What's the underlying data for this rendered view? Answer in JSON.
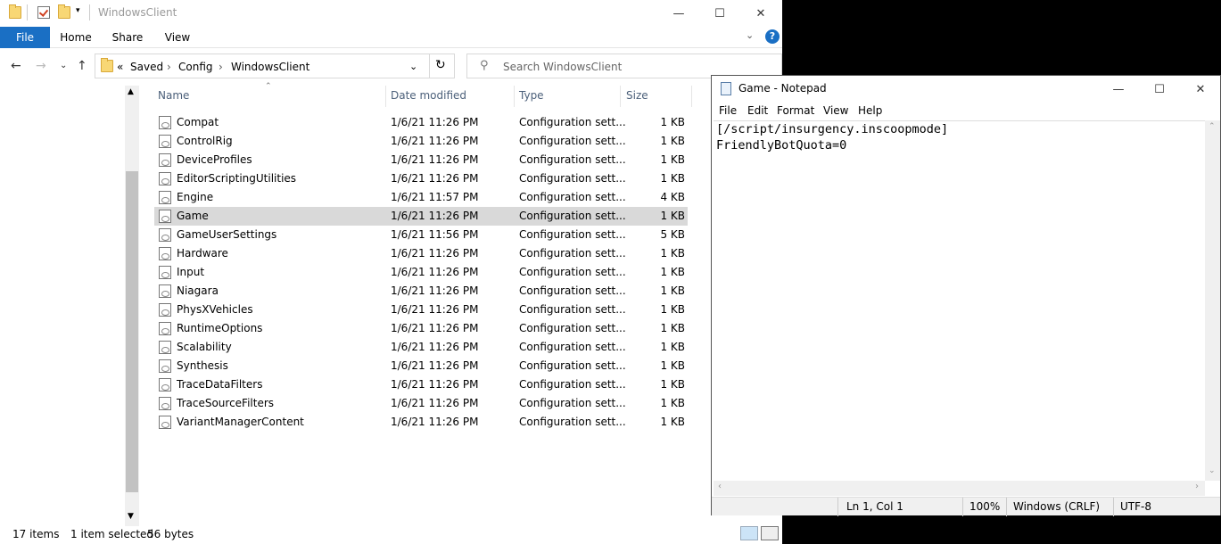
{
  "explorer": {
    "title": "WindowsClient",
    "tabs": {
      "file": "File",
      "home": "Home",
      "share": "Share",
      "view": "View"
    },
    "breadcrumbs": [
      "Saved",
      "Config",
      "WindowsClient"
    ],
    "search_placeholder": "Search WindowsClient",
    "columns": {
      "name": "Name",
      "date": "Date modified",
      "type": "Type",
      "size": "Size"
    },
    "files": [
      {
        "name": "Compat",
        "date": "1/6/21 11:26 PM",
        "type": "Configuration sett...",
        "size": "1 KB"
      },
      {
        "name": "ControlRig",
        "date": "1/6/21 11:26 PM",
        "type": "Configuration sett...",
        "size": "1 KB"
      },
      {
        "name": "DeviceProfiles",
        "date": "1/6/21 11:26 PM",
        "type": "Configuration sett...",
        "size": "1 KB"
      },
      {
        "name": "EditorScriptingUtilities",
        "date": "1/6/21 11:26 PM",
        "type": "Configuration sett...",
        "size": "1 KB"
      },
      {
        "name": "Engine",
        "date": "1/6/21 11:57 PM",
        "type": "Configuration sett...",
        "size": "4 KB"
      },
      {
        "name": "Game",
        "date": "1/6/21 11:26 PM",
        "type": "Configuration sett...",
        "size": "1 KB"
      },
      {
        "name": "GameUserSettings",
        "date": "1/6/21 11:56 PM",
        "type": "Configuration sett...",
        "size": "5 KB"
      },
      {
        "name": "Hardware",
        "date": "1/6/21 11:26 PM",
        "type": "Configuration sett...",
        "size": "1 KB"
      },
      {
        "name": "Input",
        "date": "1/6/21 11:26 PM",
        "type": "Configuration sett...",
        "size": "1 KB"
      },
      {
        "name": "Niagara",
        "date": "1/6/21 11:26 PM",
        "type": "Configuration sett...",
        "size": "1 KB"
      },
      {
        "name": "PhysXVehicles",
        "date": "1/6/21 11:26 PM",
        "type": "Configuration sett...",
        "size": "1 KB"
      },
      {
        "name": "RuntimeOptions",
        "date": "1/6/21 11:26 PM",
        "type": "Configuration sett...",
        "size": "1 KB"
      },
      {
        "name": "Scalability",
        "date": "1/6/21 11:26 PM",
        "type": "Configuration sett...",
        "size": "1 KB"
      },
      {
        "name": "Synthesis",
        "date": "1/6/21 11:26 PM",
        "type": "Configuration sett...",
        "size": "1 KB"
      },
      {
        "name": "TraceDataFilters",
        "date": "1/6/21 11:26 PM",
        "type": "Configuration sett...",
        "size": "1 KB"
      },
      {
        "name": "TraceSourceFilters",
        "date": "1/6/21 11:26 PM",
        "type": "Configuration sett...",
        "size": "1 KB"
      },
      {
        "name": "VariantManagerContent",
        "date": "1/6/21 11:26 PM",
        "type": "Configuration sett...",
        "size": "1 KB"
      }
    ],
    "selected": "Game",
    "status": {
      "items": "17 items",
      "selected": "1 item selected",
      "size": "56 bytes"
    }
  },
  "notepad": {
    "title": "Game - Notepad",
    "menu": [
      "File",
      "Edit",
      "Format",
      "View",
      "Help"
    ],
    "content": [
      "[/script/insurgency.inscoopmode]",
      "FriendlyBotQuota=0"
    ],
    "status": {
      "position": "Ln 1, Col 1",
      "zoom": "100%",
      "line_ending": "Windows (CRLF)",
      "encoding": "UTF-8"
    }
  }
}
